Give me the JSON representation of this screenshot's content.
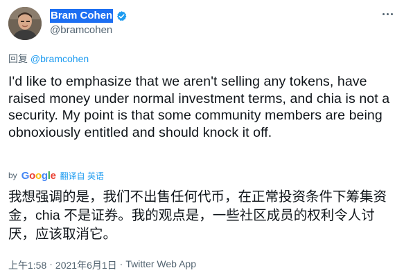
{
  "author": {
    "display_name": "Bram Cohen",
    "handle": "@bramcohen",
    "verified": true,
    "avatar_icon": "profile-photo"
  },
  "reply": {
    "prefix": "回复",
    "mention": "@bramcohen"
  },
  "tweet": {
    "text": "I'd like to emphasize that we aren't selling any tokens, have raised money under normal investment terms, and chia is not a security. My point is that some community members are being obnoxiously entitled and should knock it off."
  },
  "translation": {
    "by_label": "by",
    "provider": "Google",
    "link_label": "翻译自 英语",
    "text": "我想强调的是，我们不出售任何代币，在正常投资条件下筹集资金，chia 不是证券。我的观点是，一些社区成员的权利令人讨厌，应该取消它。"
  },
  "meta": {
    "time": "上午1:58",
    "separator1": "·",
    "date": "2021年6月1日",
    "separator2": "·",
    "source": "Twitter Web App"
  },
  "colors": {
    "link": "#1d9bf0",
    "name_highlight": "#1d6ff2",
    "secondary_text": "#536471",
    "primary_text": "#0f1419"
  }
}
